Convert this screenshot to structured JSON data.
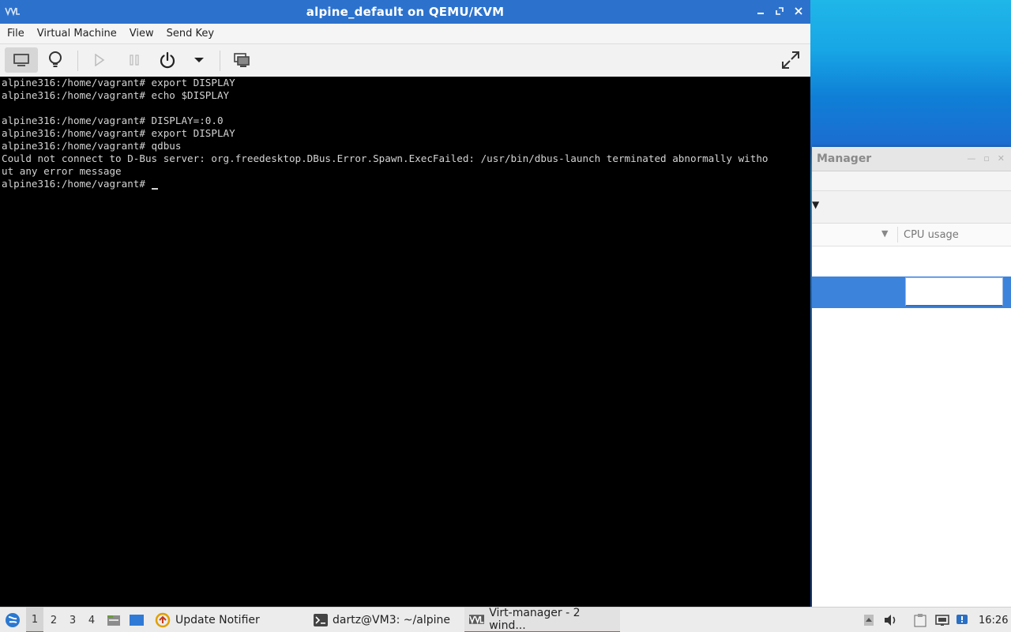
{
  "main_window": {
    "title": "alpine_default on QEMU/KVM",
    "menu": [
      "File",
      "Virtual Machine",
      "View",
      "Send Key"
    ],
    "toolbar_icons": [
      "console-icon",
      "details-lightbulb-icon",
      "run-icon",
      "pause-icon",
      "power-icon",
      "power-menu-chevron-icon",
      "snapshots-icon",
      "fullscreen-icon"
    ],
    "console_lines": [
      "alpine316:/home/vagrant# export DISPLAY",
      "alpine316:/home/vagrant# echo $DISPLAY",
      "",
      "alpine316:/home/vagrant# DISPLAY=:0.0",
      "alpine316:/home/vagrant# export DISPLAY",
      "alpine316:/home/vagrant# qdbus",
      "Could not connect to D-Bus server: org.freedesktop.DBus.Error.Spawn.ExecFailed: /usr/bin/dbus-launch terminated abnormally witho",
      "ut any error message"
    ],
    "prompt": "alpine316:/home/vagrant# "
  },
  "background_window": {
    "title_visible": "Manager",
    "column_cpu": "CPU usage"
  },
  "taskbar": {
    "desktops": [
      "1",
      "2",
      "3",
      "4"
    ],
    "tasks": {
      "update": "Update Notifier",
      "terminal": "dartz@VM3: ~/alpine",
      "virt": "Virt-manager - 2 wind..."
    },
    "clock": "16:26"
  },
  "colors": {
    "titlebar": "#2c72cd",
    "console_bg": "#000000",
    "console_fg": "#d4d4d4",
    "selection": "#3c83dc",
    "taskbar_bg": "#ececec"
  }
}
